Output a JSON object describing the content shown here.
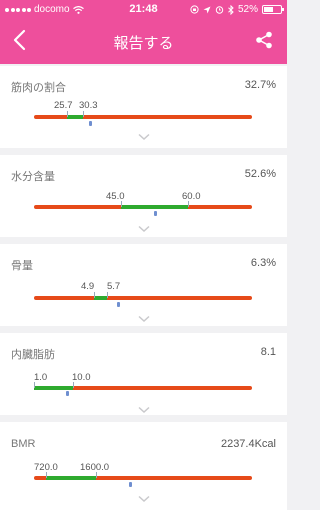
{
  "status_bar": {
    "carrier": "docomo",
    "time": "21:48",
    "battery": "52%"
  },
  "nav": {
    "title": "報告する",
    "back_icon": "chevron-left-icon",
    "share_icon": "share-icon"
  },
  "colors": {
    "header": "#ee4f9c",
    "high": "#e64a19",
    "normal": "#2eaa2e",
    "marker": "#6f8fd0"
  },
  "metrics": [
    {
      "label": "筋肉の割合",
      "value": "32.7%",
      "low": "25.7",
      "high": "30.3",
      "marker_fraction": 0.25
    },
    {
      "label": "水分含量",
      "value": "52.6%",
      "low": "45.0",
      "high": "60.0",
      "marker_fraction": 0.56
    },
    {
      "label": "骨量",
      "value": "6.3%",
      "low": "4.9",
      "high": "5.7",
      "marker_fraction": 0.38
    },
    {
      "label": "内臓脂肪",
      "value": "8.1",
      "low": "1.0",
      "high": "10.0",
      "marker_fraction": 0.15
    },
    {
      "label": "BMR",
      "value": "2237.4Kcal",
      "low": "720.0",
      "high": "1600.0",
      "marker_fraction": 0.44
    }
  ]
}
